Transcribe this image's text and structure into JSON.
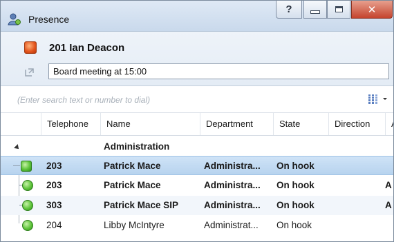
{
  "window": {
    "title": "Presence",
    "help_label": "?",
    "close_label": "✕"
  },
  "user": {
    "name": "201 Ian Deacon",
    "status_color": "#e2531b",
    "note": "Board meeting at 15:00"
  },
  "search": {
    "placeholder": "(Enter search text or number to dial)"
  },
  "table": {
    "columns": [
      "Telephone",
      "Name",
      "Department",
      "State",
      "Direction",
      "A"
    ],
    "group": "Administration",
    "rows": [
      {
        "telephone": "203",
        "name": "Patrick Mace",
        "department": "Administra...",
        "state": "On hook",
        "direction": "",
        "extra": "",
        "bold": true,
        "selected": true
      },
      {
        "telephone": "203",
        "name": "Patrick Mace",
        "department": "Administra...",
        "state": "On hook",
        "direction": "",
        "extra": "A",
        "bold": true,
        "selected": false
      },
      {
        "telephone": "303",
        "name": "Patrick Mace SIP",
        "department": "Administra...",
        "state": "On hook",
        "direction": "",
        "extra": "A",
        "bold": true,
        "selected": false
      },
      {
        "telephone": "204",
        "name": "Libby McIntyre",
        "department": "Administrat...",
        "state": "On hook",
        "direction": "",
        "extra": "",
        "bold": false,
        "selected": false
      }
    ],
    "available_color": "#5ec43a"
  }
}
